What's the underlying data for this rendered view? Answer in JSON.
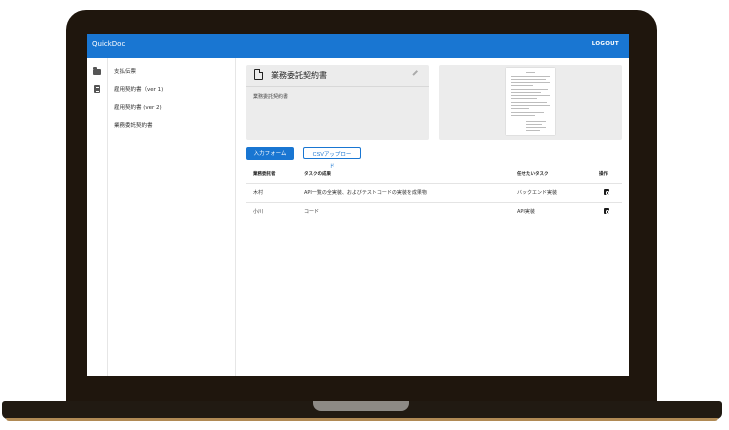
{
  "app": {
    "title": "QuickDoc",
    "logout_label": "LOGOUT"
  },
  "doc_list": [
    {
      "label": "支払伝票"
    },
    {
      "label": "雇用契約書（ver 1)"
    },
    {
      "label": "雇用契約書 (ver 2)"
    },
    {
      "label": "業務委託契約書"
    }
  ],
  "document": {
    "title": "業務委託契約書",
    "description": "業務委託契約書"
  },
  "buttons": {
    "input_form": "入力フォーム",
    "csv_upload": "CSVアップロード"
  },
  "table": {
    "headers": [
      "業務委託者",
      "タスクの成果",
      "任せたいタスク",
      "操作"
    ],
    "rows": [
      {
        "worker": "木村",
        "result": "API一覧の全実装、およびテストコードの実装を成果物",
        "task": "バックエンド実装"
      },
      {
        "worker": "小川",
        "result": "コード",
        "task": "API実装"
      }
    ]
  },
  "icons": {
    "rail_top": "folder-icon",
    "rail_second": "document-icon",
    "card": "file-icon",
    "edit": "pencil-icon",
    "row_action": "document-search-icon"
  },
  "colors": {
    "primary": "#1976d2",
    "laptop_frame": "#1f160d"
  }
}
